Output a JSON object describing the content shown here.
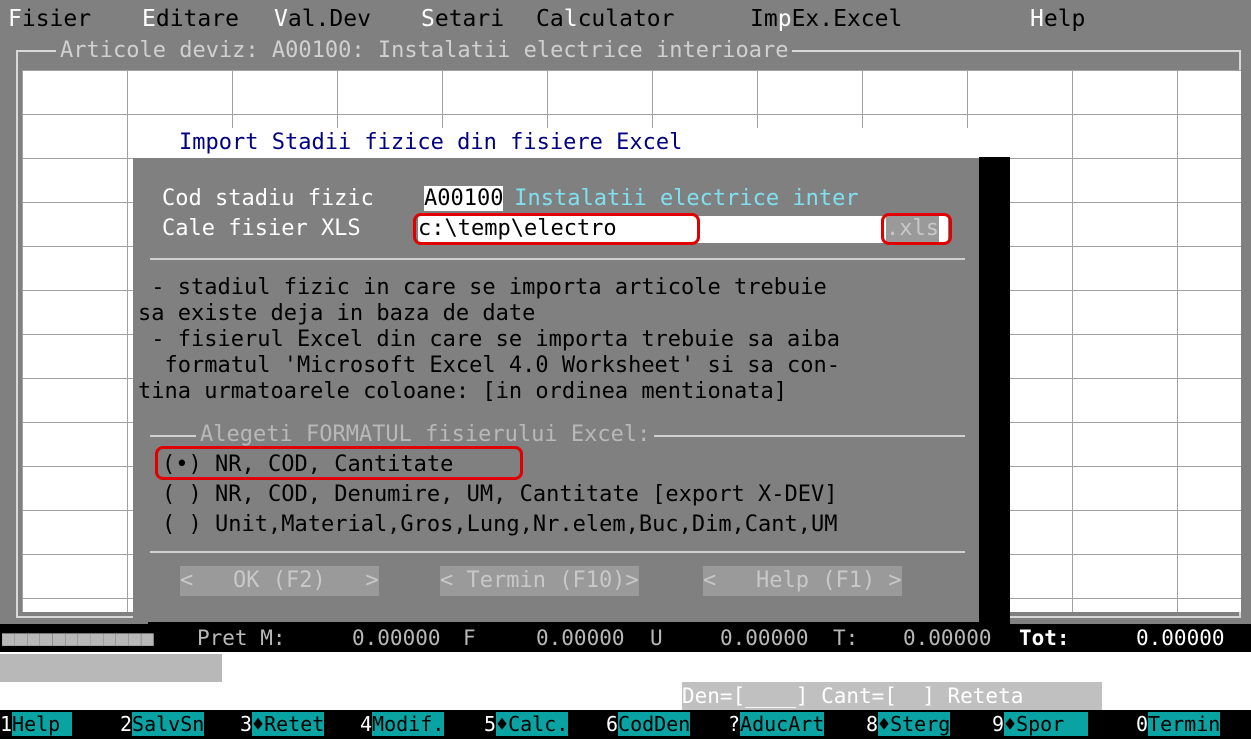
{
  "menu": [
    {
      "hot": "F",
      "rest": "isier"
    },
    {
      "hot": "E",
      "rest": "ditare"
    },
    {
      "hot": "V",
      "rest": "al.Dev"
    },
    {
      "hot": "S",
      "rest": "etari"
    },
    {
      "hot": "Ca",
      "rest": "l",
      "rest2": "culator"
    },
    {
      "hot": "Im",
      "rest": "p",
      "rest2": "Ex.Excel"
    },
    {
      "hot": "H",
      "rest": "elp"
    }
  ],
  "window": {
    "title": "Articole deviz: A00100: Instalatii electrice interioare"
  },
  "dialog": {
    "title": "Import Stadii fizice din fisiere Excel",
    "cod_label": "Cod stadiu fizic ",
    "cod_value": "A00100",
    "cod_desc": " Instalatii electrice inter",
    "path_label": "Cale fisier XLS ",
    "path_value": "c:\\temp\\electro",
    "ext": ".xls",
    "info_lines": [
      " - stadiul fizic in care se importa articole trebuie",
      "sa existe deja in baza de date",
      " - fisierul Excel din care se importa trebuie sa aiba",
      "  formatul 'Microsoft Excel 4.0 Worksheet' si sa con-",
      "tina urmatoarele coloane: [in ordinea mentionata]"
    ],
    "format_group": "Alegeti FORMATUL fisierului Excel:",
    "options": [
      {
        "mark": "(•)",
        "label": "NR, COD, Cantitate"
      },
      {
        "mark": "( )",
        "label": "NR, COD, Denumire, UM, Cantitate [export X-DEV]"
      },
      {
        "mark": "( )",
        "label": "Unit,Material,Gros,Lung,Nr.elem,Buc,Dim,Cant,UM"
      }
    ],
    "buttons": {
      "ok": "<   OK (F2)   >",
      "termin": "< Termin (F10)>",
      "help": "<   Help (F1) >"
    }
  },
  "status": {
    "blocks": "■■■■■■■■■■■■",
    "pret_label": "Pret M:",
    "m_value": "0.00000",
    "f_label": "F",
    "f_value": "0.00000",
    "u_label": "U",
    "u_value": "0.00000",
    "t_label": "T:",
    "t_value": "0.00000",
    "tot_label": "Tot:",
    "tot_value": "0.00000"
  },
  "infoline": "Den=[____] Cant=[  ] Reteta",
  "fkeys": [
    {
      "num": "1",
      "label": "Help "
    },
    {
      "num": "2",
      "label": "SalvSn"
    },
    {
      "num": "3",
      "label": "♦Retet"
    },
    {
      "num": "4",
      "label": "Modif."
    },
    {
      "num": "5",
      "label": "♦Calc."
    },
    {
      "num": "6",
      "label": "CodDen"
    },
    {
      "num": "?",
      "label": "AducArt"
    },
    {
      "num": "8",
      "label": "♦Sterg"
    },
    {
      "num": "9",
      "label": "♦Spor  "
    },
    {
      "num": "0",
      "label": "Termin"
    }
  ]
}
